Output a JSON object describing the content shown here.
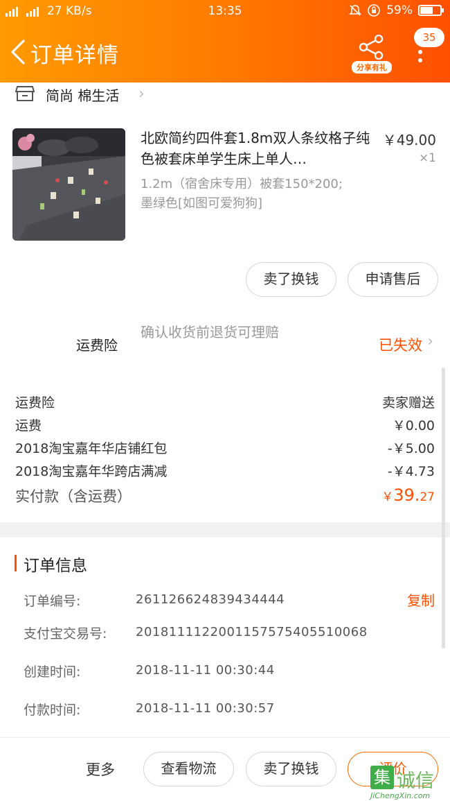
{
  "status_bar": {
    "network_speed": "27 KB/s",
    "time": "13:35",
    "battery": "59%",
    "battery_level": 0.59,
    "signal_1": "2G",
    "signal_2": "4G"
  },
  "header": {
    "title": "订单详情",
    "share_label": "分享有礼",
    "message_count": "35"
  },
  "shop": {
    "name": "简尚 棉生活"
  },
  "product": {
    "title": "北欧简约四件套1.8m双人条纹格子纯色被套床单学生床上单人…",
    "sku_line1": "1.2m（宿舍床专用）被套150*200;",
    "sku_line2": "墨绿色[如图可爱狗狗]",
    "price": "￥49.00",
    "quantity": "×1"
  },
  "item_actions": {
    "resell": "卖了换钱",
    "after_sales": "申请售后"
  },
  "insurance": {
    "label": "运费险",
    "description": "确认收货前退货可理赔",
    "status": "已失效"
  },
  "fees": [
    {
      "label": "运费险",
      "value": "卖家赠送"
    },
    {
      "label": "运费",
      "value": "￥0.00"
    },
    {
      "label": "2018淘宝嘉年华店铺红包",
      "value": "-￥5.00"
    },
    {
      "label": "2018淘宝嘉年华跨店满减",
      "value": "-￥4.73"
    }
  ],
  "total": {
    "label": "实付款（含运费）",
    "currency": "￥",
    "amount_int": "39.",
    "amount_dec": "27"
  },
  "order_info": {
    "title": "订单信息",
    "copy_label": "复制",
    "rows": [
      {
        "label": "订单编号:",
        "value": "261126624839434444"
      },
      {
        "label": "支付宝交易号:",
        "value": "2018111122001157575405510068"
      },
      {
        "label": "创建时间:",
        "value": "2018-11-11 00:30:44"
      },
      {
        "label": "付款时间:",
        "value": "2018-11-11 00:30:57"
      }
    ]
  },
  "bottom_bar": {
    "more": "更多",
    "logistics": "查看物流",
    "resell": "卖了换钱",
    "review": "评价"
  },
  "watermark": {
    "mark": "集",
    "text": "诚信",
    "domain": "JiChengXin.com"
  },
  "colors": {
    "accent": "#ff5000",
    "header_start": "#ff9a00",
    "header_end": "#ff5000"
  }
}
